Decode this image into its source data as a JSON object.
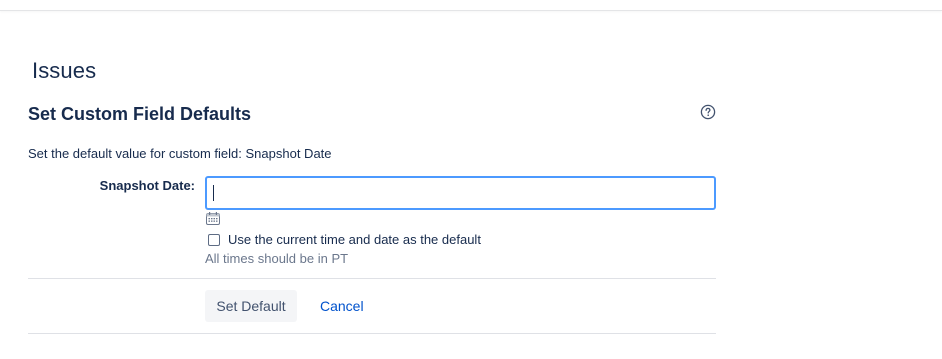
{
  "page": {
    "heading": "Issues"
  },
  "section": {
    "title": "Set Custom Field Defaults",
    "help_icon": "question-circle-icon"
  },
  "form": {
    "description": "Set the default value for custom field: Snapshot Date",
    "field_label": "Snapshot Date:",
    "field_value": "",
    "calendar_icon": "calendar-icon",
    "checkbox_label": "Use the current time and date as the default",
    "checkbox_checked": false,
    "hint": "All times should be in PT"
  },
  "actions": {
    "set_default_label": "Set Default",
    "cancel_label": "Cancel"
  },
  "colors": {
    "text": "#172b4d",
    "link": "#0052cc",
    "focus_border": "#4c9aff",
    "hint": "#6b778c",
    "button_bg": "#f4f5f7"
  }
}
